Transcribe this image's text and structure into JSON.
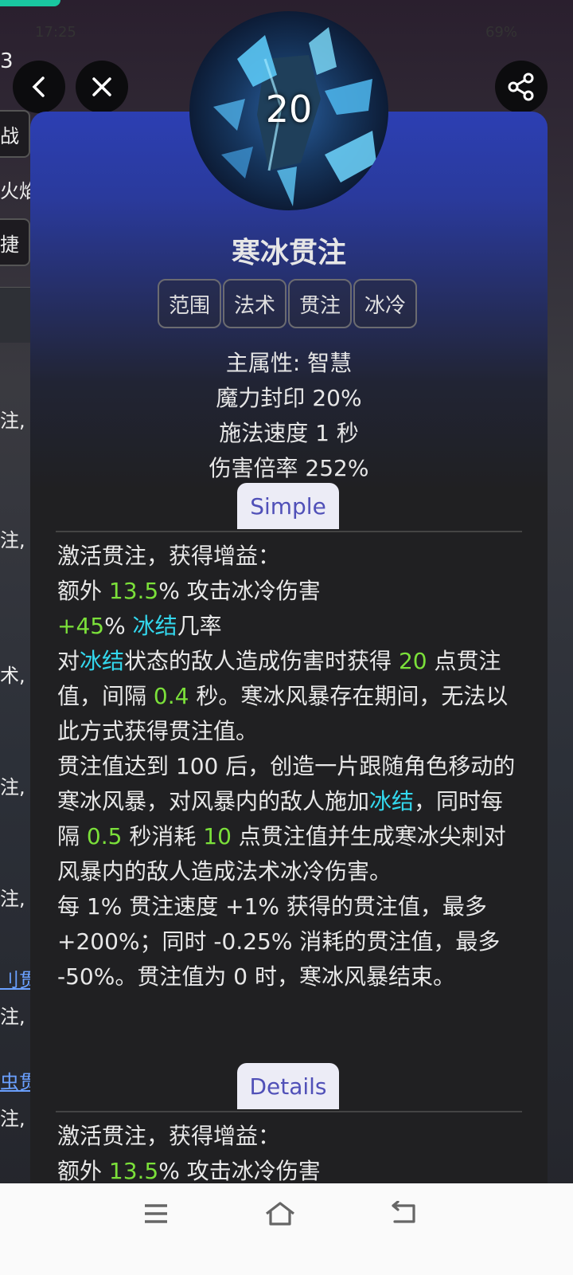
{
  "status_bar": {
    "time": "17:25",
    "battery": "69%"
  },
  "background_sidebar": {
    "top_char": "3",
    "items": [
      "战",
      "火焰",
      "捷"
    ],
    "rows": [
      "注, ",
      "注, ",
      "术, ",
      "注, ",
      "注, ",
      "注, ",
      "注, "
    ],
    "links": [
      "刂贯",
      "虫贯"
    ]
  },
  "header": {
    "back_icon": "chevron-left-icon",
    "close_icon": "close-icon",
    "share_icon": "share-icon"
  },
  "skill": {
    "level": "20",
    "name": "寒冰贯注",
    "tags": [
      "范围",
      "法术",
      "贯注",
      "冰冷"
    ],
    "stats": {
      "main_attr": "主属性:  智慧",
      "mana_seal": "魔力封印 20%",
      "cast_speed": "施法速度 1 秒",
      "damage_mult": "伤害倍率 252%"
    },
    "simple_label": "Simple",
    "details_label": "Details",
    "colors": {
      "number": "#7be03a",
      "keyword": "#33d8ee",
      "button_text": "#5050b8"
    },
    "simple_desc": {
      "p1": "激活贯注，获得增益：",
      "p2_a": "额外 ",
      "p2_b": "13.5",
      "p2_c": "% 攻击冰冷伤害",
      "p3_a": "+45",
      "p3_b": "% ",
      "p3_c": "冰结",
      "p3_d": "几率",
      "p4_a": "对",
      "p4_b": "冰结",
      "p4_c": "状态的敌人造成伤害时获得 ",
      "p4_d": "20",
      "p4_e": " 点贯注值，间隔 ",
      "p4_f": "0.4",
      "p4_g": " 秒。寒冰风暴存在期间，无法以此方式获得贯注值。",
      "p5_a": "贯注值达到 100 后，创造一片跟随角色移动的寒冰风暴，对风暴内的敌人施加",
      "p5_b": "冰结",
      "p5_c": "，同时每隔 ",
      "p5_d": "0.5",
      "p5_e": " 秒消耗 ",
      "p5_f": "10",
      "p5_g": " 点贯注值并生成寒冰尖刺对风暴内的敌人造成法术冰冷伤害。",
      "p6": "每 1% 贯注速度 +1% 获得的贯注值，最多 +200%；同时 -0.25% 消耗的贯注值，最多 -50%。贯注值为 0 时，寒冰风暴结束。"
    },
    "details_desc": {
      "p1": "激活贯注，获得增益：",
      "p2_a": "额外 ",
      "p2_b": "13.5",
      "p2_c": "% 攻击冰冷伤害"
    }
  },
  "nav_bar": {
    "menu_icon": "menu-icon",
    "home_icon": "home-icon",
    "back_icon": "back-icon"
  }
}
